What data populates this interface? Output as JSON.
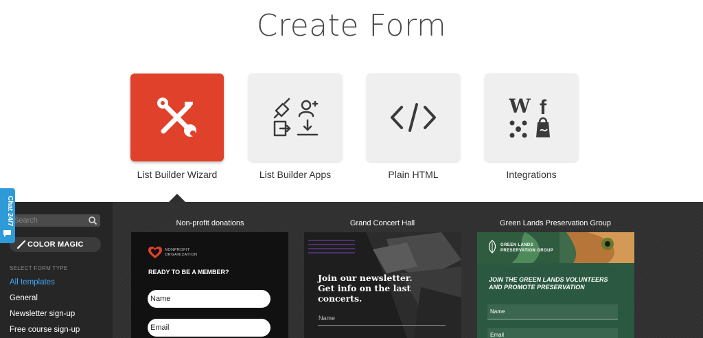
{
  "page": {
    "title": "Create Form"
  },
  "options": [
    {
      "label": "List Builder Wizard",
      "icon": "tools-icon",
      "active": true
    },
    {
      "label": "List Builder Apps",
      "icon": "apps-grid-icon"
    },
    {
      "label": "Plain HTML",
      "icon": "code-icon"
    },
    {
      "label": "Integrations",
      "icon": "integrations-icon"
    }
  ],
  "sidebar": {
    "search_placeholder": "Search",
    "color_magic": "COLOR MAGIC",
    "section_title": "SELECT FORM TYPE",
    "filters": [
      "All templates",
      "General",
      "Newsletter sign-up",
      "Free course sign-up"
    ],
    "active_filter": "All templates"
  },
  "chat": {
    "label": "Chat 24/7"
  },
  "templates": [
    {
      "title": "Non-profit donations",
      "org_line1": "NONPROFIT",
      "org_line2": "ORGANIZATION",
      "heading": "READY TO BE A MEMBER?",
      "fields": [
        "Name",
        "Email"
      ]
    },
    {
      "title": "Grand Concert Hall",
      "heading": "Join our newsletter. Get info on the last concerts.",
      "fields": [
        "Name"
      ]
    },
    {
      "title": "Green Lands Preservation Group",
      "logo_line1": "GREEN LANDS",
      "logo_line2": "PRESERVATION GROUP",
      "heading": "JOIN THE GREEN LANDS VOLUNTEERS AND PROMOTE PRESERVATION",
      "fields": [
        "Name",
        "Email"
      ]
    }
  ],
  "colors": {
    "accent_red": "#e0412b",
    "link_blue": "#42a7f5",
    "chat_blue": "#2e9ad8",
    "panel_dark": "#2f2f2f"
  }
}
